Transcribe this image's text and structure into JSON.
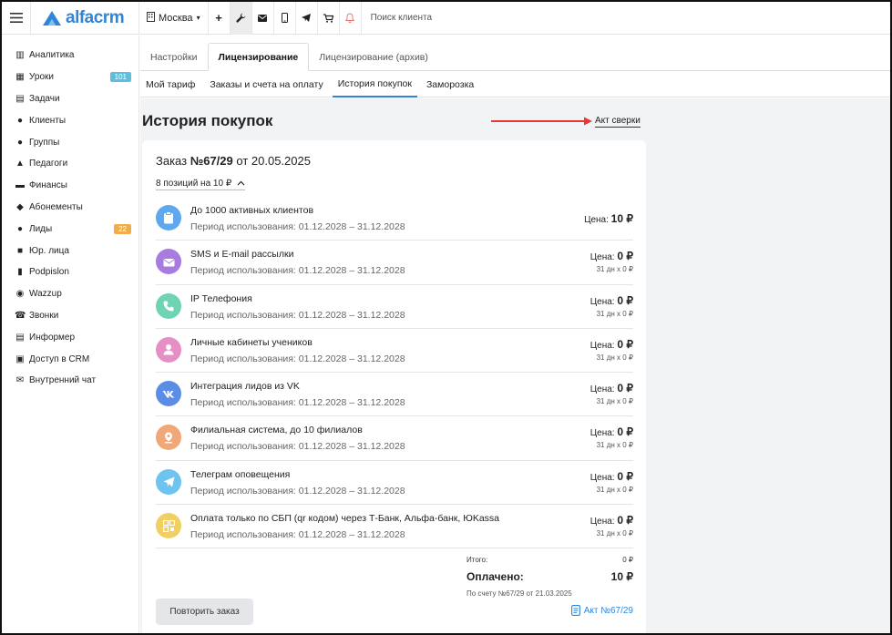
{
  "topbar": {
    "logo": "alfacrm",
    "city": "Москва",
    "search_placeholder": "Поиск клиента"
  },
  "sidebar": {
    "items": [
      {
        "label": "Аналитика",
        "icon": "book-icon"
      },
      {
        "label": "Уроки",
        "icon": "calendar-icon",
        "badge": "101",
        "badge_color": "#5bc0de"
      },
      {
        "label": "Задачи",
        "icon": "list-icon"
      },
      {
        "label": "Клиенты",
        "icon": "user-icon"
      },
      {
        "label": "Группы",
        "icon": "users-icon"
      },
      {
        "label": "Педагоги",
        "icon": "graduation-cap-icon"
      },
      {
        "label": "Финансы",
        "icon": "money-icon"
      },
      {
        "label": "Абонементы",
        "icon": "tag-icon"
      },
      {
        "label": "Лиды",
        "icon": "user-plus-icon",
        "badge": "22",
        "badge_color": "#f0ad4e"
      },
      {
        "label": "Юр. лица",
        "icon": "briefcase-icon"
      },
      {
        "label": "Podpislon",
        "icon": "document-icon"
      },
      {
        "label": "Wazzup",
        "icon": "whatsapp-icon"
      },
      {
        "label": "Звонки",
        "icon": "phone-icon"
      },
      {
        "label": "Информер",
        "icon": "database-icon"
      },
      {
        "label": "Доступ в CRM",
        "icon": "lock-icon"
      },
      {
        "label": "Внутренний чат",
        "icon": "envelope-icon"
      }
    ]
  },
  "tabs_main": [
    "Настройки",
    "Лицензирование",
    "Лицензирование (архив)"
  ],
  "tabs_sub": [
    "Мой тариф",
    "Заказы и счета на оплату",
    "История покупок",
    "Заморозка"
  ],
  "page": {
    "title": "История покупок",
    "akt_link": "Акт сверки"
  },
  "order": {
    "title_prefix": "Заказ",
    "number": "№67/29",
    "date_text": "от 20.05.2025",
    "positions_summary": "8 позиций на 10 ₽",
    "items": [
      {
        "name": "До 1000 активных клиентов",
        "period": "Период использования: 01.12.2028 – 31.12.2028",
        "price_label": "Цена:",
        "price": "10 ₽",
        "sub": "",
        "icon": "clipboard-icon",
        "color": "#5ea8f0"
      },
      {
        "name": "SMS и E-mail рассылки",
        "period": "Период использования: 01.12.2028 – 31.12.2028",
        "price_label": "Цена:",
        "price": "0 ₽",
        "sub": "31 дн x 0 ₽",
        "icon": "mail-icon",
        "color": "#a77be0"
      },
      {
        "name": "IP Телефония",
        "period": "Период использования: 01.12.2028 – 31.12.2028",
        "price_label": "Цена:",
        "price": "0 ₽",
        "sub": "31 дн x 0 ₽",
        "icon": "phone-icon",
        "color": "#6fd3b5"
      },
      {
        "name": "Личные кабинеты учеников",
        "period": "Период использования: 01.12.2028 – 31.12.2028",
        "price_label": "Цена:",
        "price": "0 ₽",
        "sub": "31 дн x 0 ₽",
        "icon": "person-icon",
        "color": "#e58fc4"
      },
      {
        "name": "Интеграция лидов из VK",
        "period": "Период использования: 01.12.2028 – 31.12.2028",
        "price_label": "Цена:",
        "price": "0 ₽",
        "sub": "31 дн x 0 ₽",
        "icon": "vk-icon",
        "color": "#5b8de6"
      },
      {
        "name": "Филиальная система, до 10 филиалов",
        "period": "Период использования: 01.12.2028 – 31.12.2028",
        "price_label": "Цена:",
        "price": "0 ₽",
        "sub": "31 дн x 0 ₽",
        "icon": "location-icon",
        "color": "#f0a878"
      },
      {
        "name": "Телеграм оповещения",
        "period": "Период использования: 01.12.2028 – 31.12.2028",
        "price_label": "Цена:",
        "price": "0 ₽",
        "sub": "31 дн x 0 ₽",
        "icon": "telegram-icon",
        "color": "#6cc4ef"
      },
      {
        "name": "Оплата только по СБП (qr кодом) через Т-Банк, Альфа-банк, ЮKassa",
        "period": "Период использования: 01.12.2028 – 31.12.2028",
        "price_label": "Цена:",
        "price": "0 ₽",
        "sub": "31 дн x 0 ₽",
        "icon": "qr-icon",
        "color": "#f2cf63"
      }
    ],
    "total_label": "Итого:",
    "total_value": "0 ₽",
    "paid_label": "Оплачено:",
    "paid_value": "10 ₽",
    "invoice_note": "По счету №67/29 от 21.03.2025",
    "repeat_button": "Повторить заказ",
    "act_link": "Акт №67/29"
  },
  "colors": {
    "accent": "#2f86d8",
    "arrow": "#e53935"
  }
}
